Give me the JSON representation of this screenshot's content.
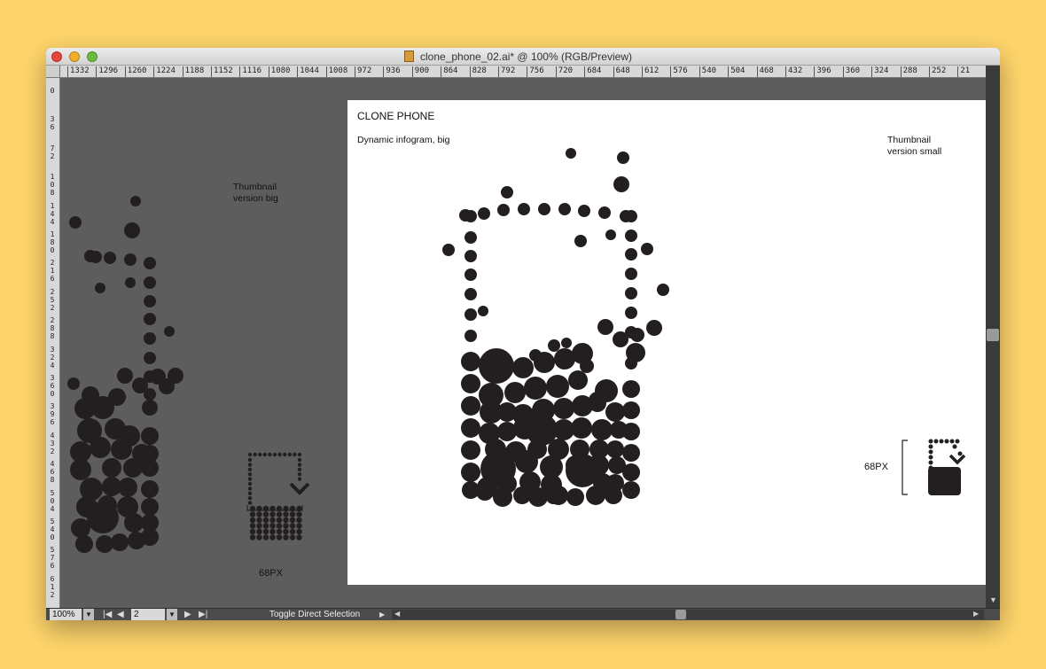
{
  "window": {
    "title": "clone_phone_02.ai* @ 100% (RGB/Preview)"
  },
  "ruler": {
    "horizontal": [
      "1332",
      "1296",
      "1260",
      "1224",
      "1188",
      "1152",
      "1116",
      "1080",
      "1044",
      "1008",
      "972",
      "936",
      "900",
      "864",
      "828",
      "792",
      "756",
      "720",
      "684",
      "648",
      "612",
      "576",
      "540",
      "504",
      "468",
      "432",
      "396",
      "360",
      "324",
      "288",
      "252",
      "21"
    ],
    "vertical": [
      "0",
      "36",
      "72",
      "108",
      "144",
      "180",
      "216",
      "252",
      "288",
      "324",
      "360",
      "396",
      "432",
      "468",
      "504",
      "540",
      "576",
      "612"
    ]
  },
  "artboard": {
    "title": "CLONE PHONE",
    "subtitle": "Dynamic infogram, big",
    "thumb_small_line1": "Thumbnail",
    "thumb_small_line2": "version small",
    "size_small": "68PX"
  },
  "pasteboard": {
    "thumb_big_line1": "Thumbnail",
    "thumb_big_line2": "version big",
    "size_big": "68PX"
  },
  "statusbar": {
    "zoom": "100%",
    "page": "2",
    "status_text": "Toggle Direct Selection"
  },
  "colors": {
    "background": "#ffd56b",
    "pasteboard": "#5d5d5d",
    "artboard": "#ffffff",
    "dots": "#231f20"
  },
  "icons": [
    "close-icon",
    "minimize-icon",
    "zoom-icon",
    "document-icon",
    "first-page-icon",
    "previous-page-icon",
    "next-page-icon",
    "last-page-icon",
    "scroll-arrow-icon"
  ]
}
